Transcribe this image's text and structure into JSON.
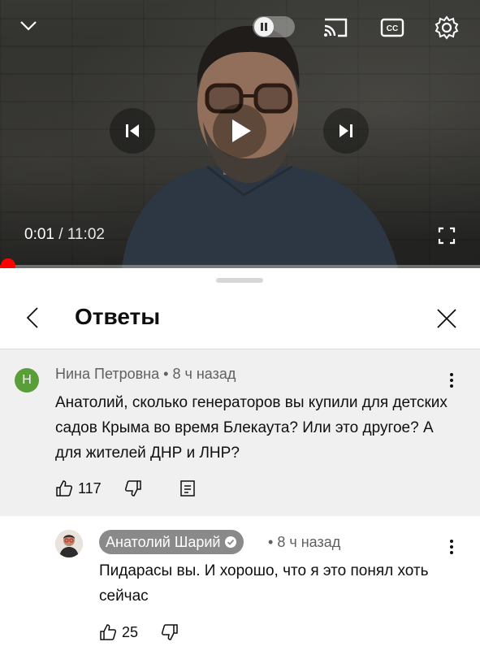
{
  "player": {
    "current_time": "0:01",
    "duration": "11:02",
    "progress_fraction": 0.0015,
    "icons": [
      "chevron-down-icon",
      "autoplay-toggle-icon",
      "cast-icon",
      "captions-icon",
      "settings-icon",
      "previous-icon",
      "play-icon",
      "next-icon",
      "fullscreen-icon"
    ],
    "accent_color": "#ff0000"
  },
  "panel": {
    "title": "Ответы"
  },
  "parent_comment": {
    "avatar_letter": "Н",
    "avatar_color": "#5a9e3a",
    "author": "Нина Петровна",
    "time": "8 ч назад",
    "text": "Анатолий, сколько генераторов вы купили для детских садов Крыма во время Блекаута? Или это другое? А для жителей ДНР и ЛНР?",
    "likes": "117"
  },
  "reply_comment": {
    "author": "Анатолий Шарий",
    "verified": true,
    "time": "8 ч назад",
    "text": "Пидарасы вы. И хорошо, что я это понял хоть сейчас",
    "likes": "25"
  }
}
